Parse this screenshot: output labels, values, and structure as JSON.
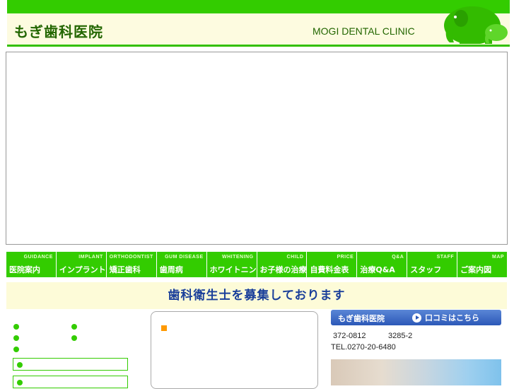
{
  "header": {
    "logo_ja": "もぎ歯科医院",
    "logo_en": "MOGI DENTAL CLINIC",
    "mascot_icon": "elephant-icon"
  },
  "nav": {
    "items": [
      {
        "en": "GUIDANCE",
        "ja": "医院案内"
      },
      {
        "en": "IMPLANT",
        "ja": "インプラント"
      },
      {
        "en": "ORTHODONTIST",
        "ja": "矯正歯科"
      },
      {
        "en": "GUM DISEASE",
        "ja": "歯周病"
      },
      {
        "en": "WHITENING",
        "ja": "ホワイトニング"
      },
      {
        "en": "CHILD",
        "ja": "お子様の治療"
      },
      {
        "en": "PRICE",
        "ja": "自費料金表"
      },
      {
        "en": "Q&A",
        "ja": "治療Q&A"
      },
      {
        "en": "STAFF",
        "ja": "スタッフ"
      },
      {
        "en": "MAP",
        "ja": "ご案内図"
      }
    ]
  },
  "banner": {
    "text": "歯科衛生士を募集しております"
  },
  "sidebar_right": {
    "clinic_name": "もぎ歯科医院",
    "review_label": "口コミはこちら",
    "postal": "372-0812",
    "address_no": "3285-2",
    "tel": "TEL.0270-20-6480"
  },
  "colors": {
    "brand_green": "#33cc00",
    "banner_text": "#1a3f9a",
    "clinic_bar": "#2c59b8"
  }
}
